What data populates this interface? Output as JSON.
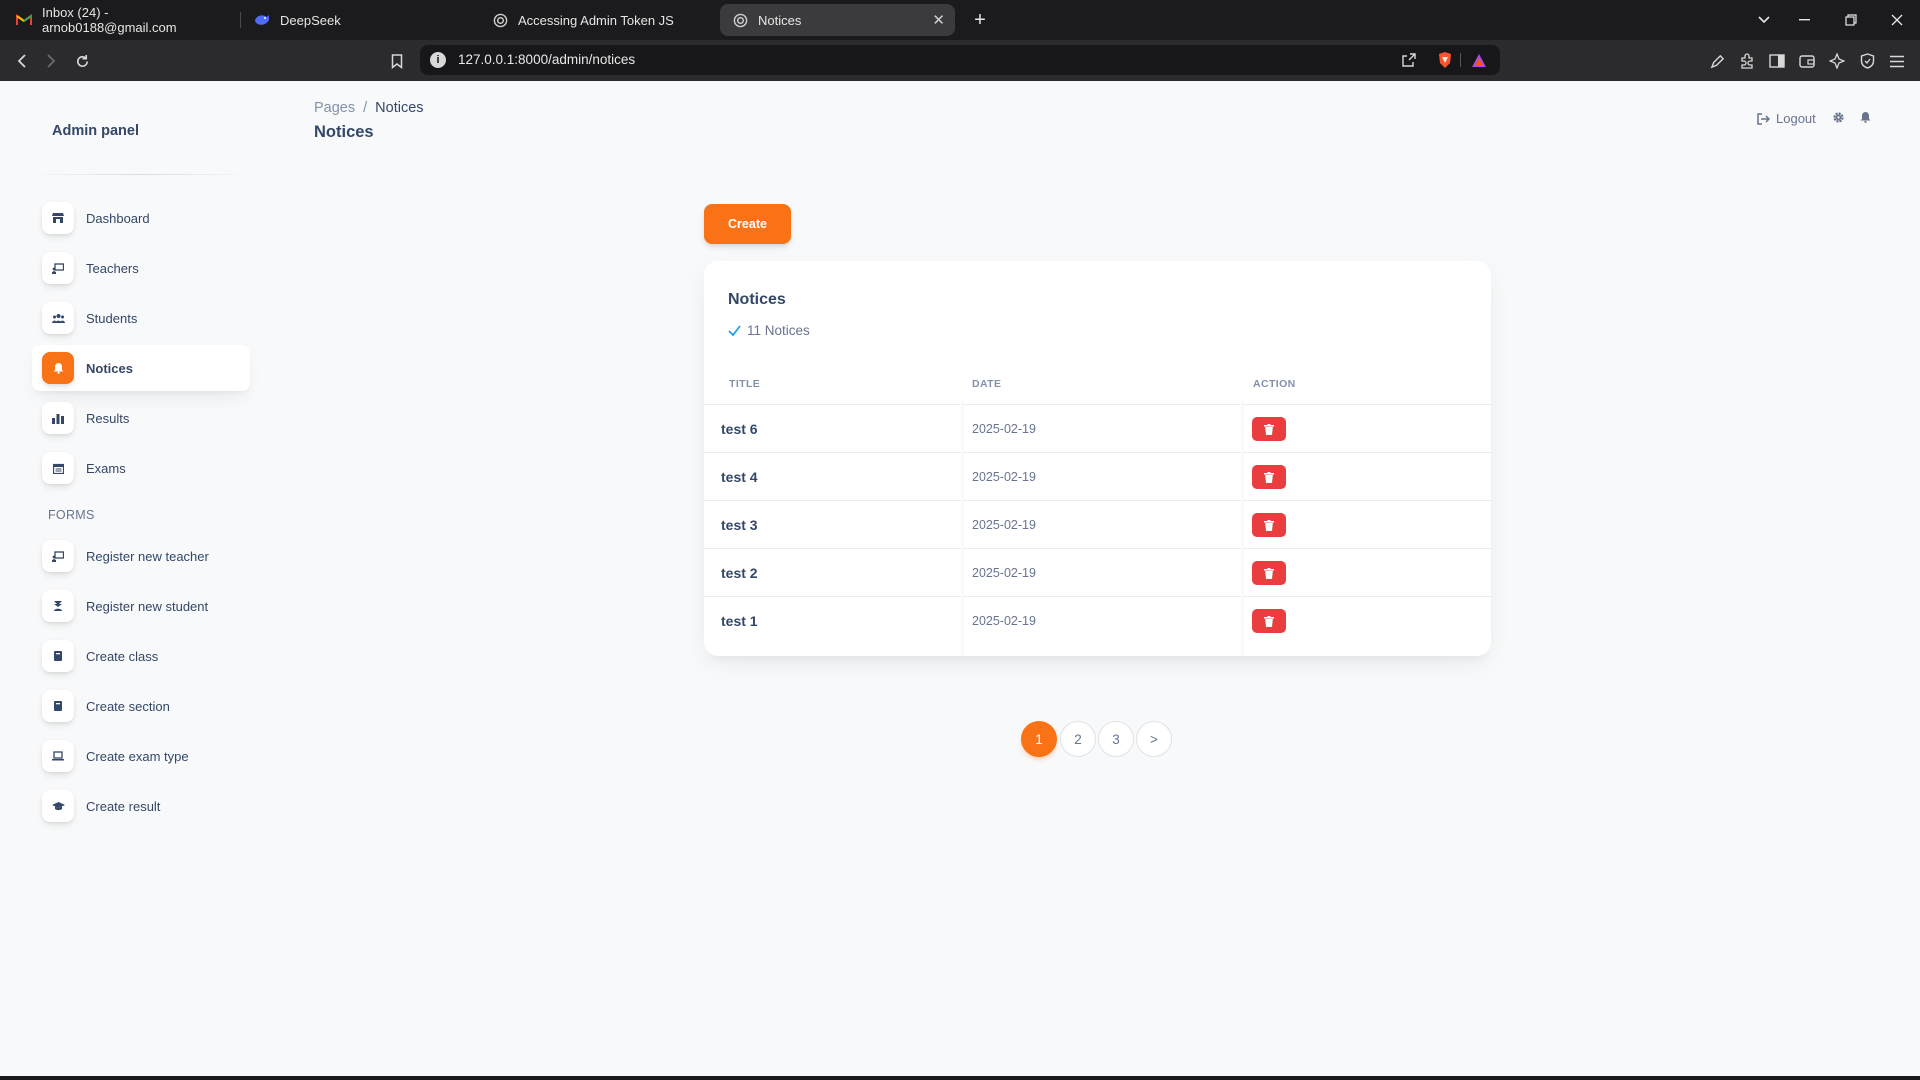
{
  "browser": {
    "tabs": [
      {
        "title": "Inbox (24) - arnob0188@gmail.com",
        "icon": "gmail-icon"
      },
      {
        "title": "DeepSeek",
        "icon": "deepseek-icon"
      },
      {
        "title": "Accessing Admin Token JS",
        "icon": "globe-icon"
      },
      {
        "title": "Notices",
        "icon": "globe-icon"
      }
    ],
    "url": "127.0.0.1:8000/admin/notices"
  },
  "sidebar": {
    "brand": "Admin panel",
    "items": [
      {
        "label": "Dashboard",
        "icon": "shop-icon"
      },
      {
        "label": "Teachers",
        "icon": "teacher-board-icon"
      },
      {
        "label": "Students",
        "icon": "users-icon"
      },
      {
        "label": "Notices",
        "icon": "bell-icon",
        "active": true
      },
      {
        "label": "Results",
        "icon": "chart-bar-icon"
      },
      {
        "label": "Exams",
        "icon": "calendar-icon"
      }
    ],
    "forms_heading": "FORMS",
    "forms": [
      {
        "label": "Register new teacher",
        "icon": "teacher-board-icon"
      },
      {
        "label": "Register new student",
        "icon": "student-icon"
      },
      {
        "label": "Create class",
        "icon": "book-icon"
      },
      {
        "label": "Create section",
        "icon": "book-icon"
      },
      {
        "label": "Create exam type",
        "icon": "laptop-icon"
      },
      {
        "label": "Create result",
        "icon": "graduation-cap-icon"
      }
    ]
  },
  "header": {
    "breadcrumb_parent": "Pages",
    "breadcrumb_current": "Notices",
    "title": "Notices",
    "logout_label": "Logout"
  },
  "main": {
    "create_label": "Create",
    "card_title": "Notices",
    "notice_count": "11 Notices",
    "columns": [
      "TITLE",
      "DATE",
      "ACTION"
    ],
    "rows": [
      {
        "title": "test 6",
        "date": "2025-02-19"
      },
      {
        "title": "test 4",
        "date": "2025-02-19"
      },
      {
        "title": "test 3",
        "date": "2025-02-19"
      },
      {
        "title": "test 2",
        "date": "2025-02-19"
      },
      {
        "title": "test 1",
        "date": "2025-02-19"
      }
    ],
    "pagination": [
      "1",
      "2",
      "3",
      ">"
    ],
    "current_page": "1"
  },
  "colors": {
    "accent": "#f97316",
    "danger": "#ea3e3e",
    "text": "#344767",
    "muted": "#8392ab"
  }
}
